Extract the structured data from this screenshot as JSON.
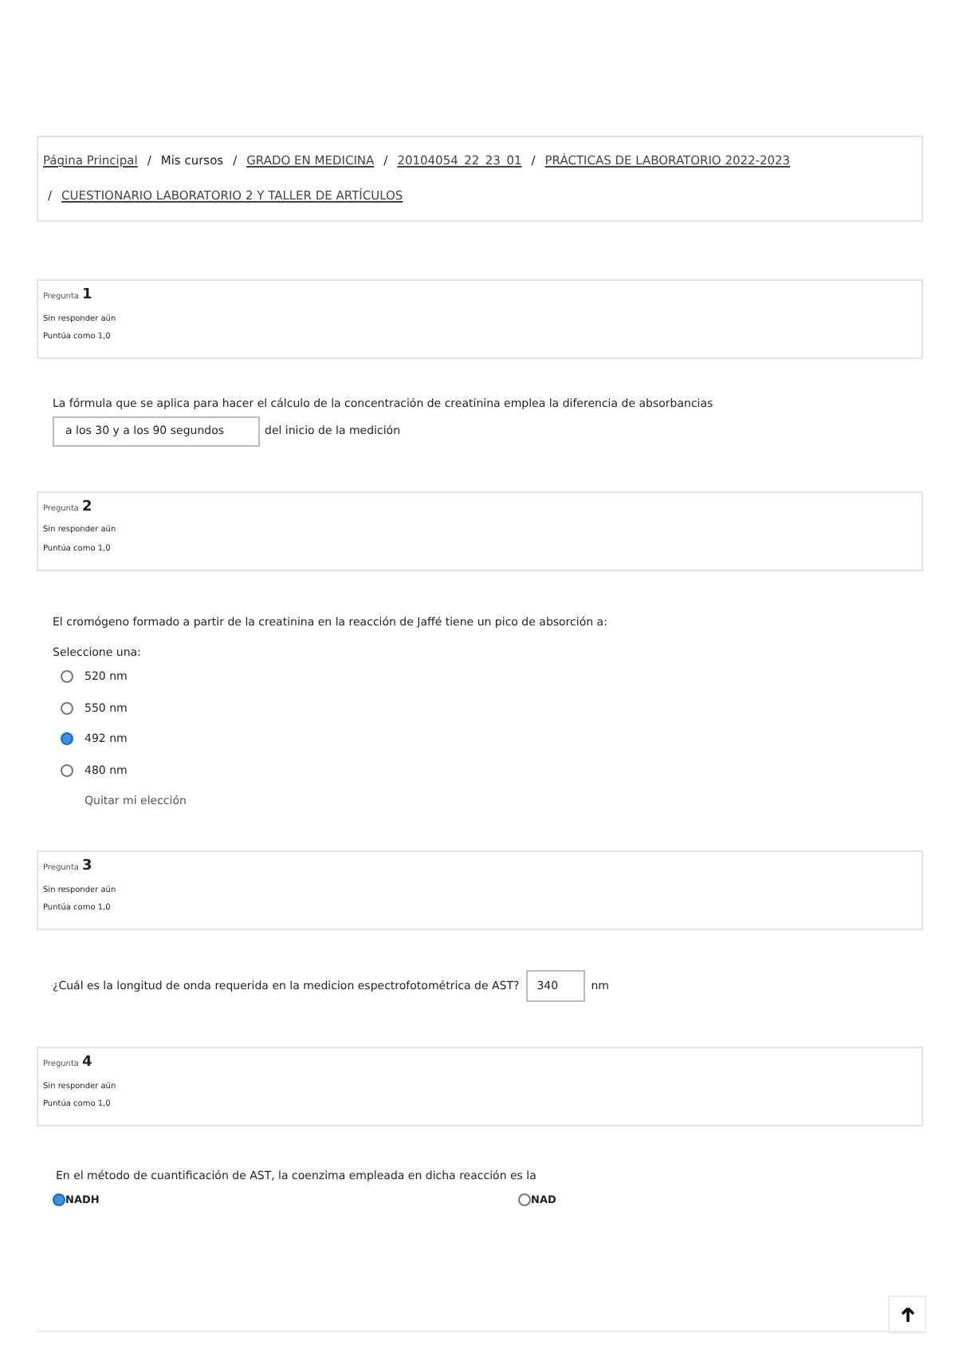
{
  "breadcrumb": [
    {
      "label": "Página Principal",
      "link": true
    },
    {
      "label": "Mis cursos",
      "link": false
    },
    {
      "label": "GRADO EN MEDICINA",
      "link": true
    },
    {
      "label": "20104054_22_23_01",
      "link": true
    },
    {
      "label": "PRÁCTICAS DE LABORATORIO 2022-2023",
      "link": true
    },
    {
      "label": "CUESTIONARIO LABORATORIO 2 Y TALLER DE ARTÍCULOS",
      "link": true
    }
  ],
  "breadcrumb_separator": "/",
  "questions": [
    {
      "label": "Pregunta",
      "number": "1",
      "status": "Sin responder aún",
      "score": "Puntúa como 1,0",
      "kind": "fill_in",
      "text": "La fórmula que se aplica para hacer el cálculo de la concentración de creatinina emplea la diferencia de absorbancias",
      "value": "a los 30 y a los 90 segundos",
      "after": "del inicio de la medición"
    },
    {
      "label": "Pregunta",
      "number": "2",
      "status": "Sin responder aún",
      "score": "Puntúa como 1,0",
      "kind": "multichoice",
      "text": "El cromógeno formado a partir de la creatinina en la reacción de Jaffé tiene un pico de absorción a:",
      "prompt": "Seleccione una:",
      "options": [
        {
          "label": "520 nm",
          "selected": false
        },
        {
          "label": "550 nm",
          "selected": false
        },
        {
          "label": "492 nm",
          "selected": true
        },
        {
          "label": "480 nm",
          "selected": false
        }
      ],
      "clear": "Quitar mi elección"
    },
    {
      "label": "Pregunta",
      "number": "3",
      "status": "Sin responder aún",
      "score": "Puntúa como 1,0",
      "kind": "numeric",
      "text": "¿Cuál es la longitud de onda requerida en la medicion espectrofotométrica de AST?",
      "value": "340",
      "after": "nm"
    },
    {
      "label": "Pregunta",
      "number": "4",
      "status": "Sin responder aún",
      "score": "Puntúa como 1,0",
      "kind": "inline_radio",
      "text": "En el método de cuantificación de AST, la coenzima empleada en dicha reacción es la",
      "options": [
        {
          "label": "NADH",
          "selected": true
        },
        {
          "label": "NAD",
          "selected": false
        }
      ]
    }
  ]
}
